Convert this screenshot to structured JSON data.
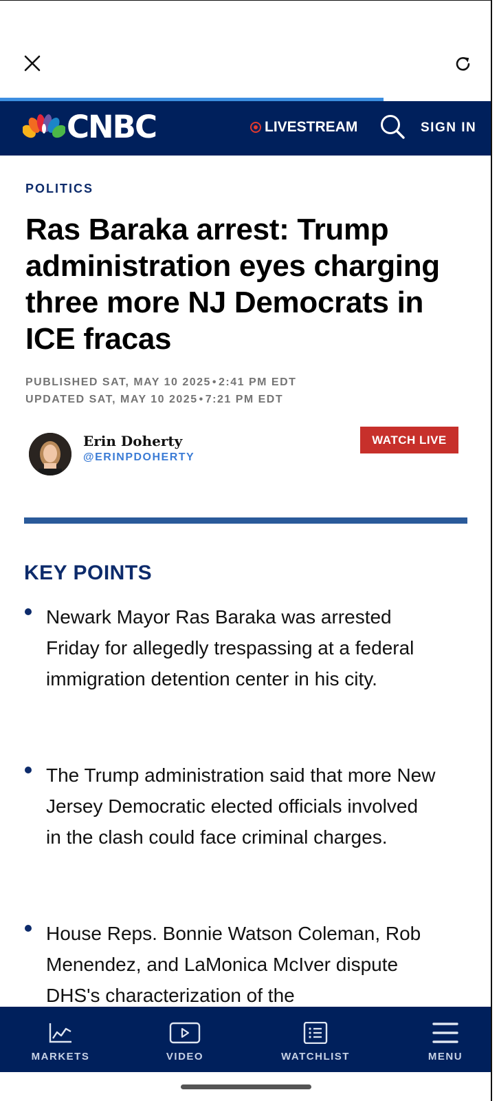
{
  "browser": {
    "close_icon": "close-icon",
    "reload_icon": "reload-icon",
    "load_progress": 0.78,
    "progress_color": "#3c8ee0"
  },
  "header": {
    "logo_text": "CNBC",
    "livestream_label": "LIVESTREAM",
    "signin_label": "SIGN IN",
    "bg_color": "#00205c",
    "live_dot_color": "#e23a2f"
  },
  "article": {
    "section": "POLITICS",
    "headline": "Ras Baraka arrest: Trump administration eyes charging three more NJ Democrats in ICE fracas",
    "published_prefix": "PUBLISHED SAT, MAY 10 2025",
    "published_time": "2:41 PM EDT",
    "updated_prefix": "UPDATED SAT, MAY 10 2025",
    "updated_time": "7:21 PM EDT",
    "separator": "•",
    "author_name": "Erin Doherty",
    "author_handle": "@ERINPDOHERTY",
    "watch_live_label": "WATCH LIVE",
    "watch_live_color": "#c7302b"
  },
  "key_points": {
    "title": "KEY POINTS",
    "items": [
      "Newark Mayor Ras Baraka was arrested Friday for allegedly trespassing at a federal immigration detention center in his city.",
      "The Trump administration said that more New Jersey Democratic elected officials involved in the clash could face criminal charges.",
      "House Reps. Bonnie Watson Coleman, Rob Menendez, and LaMonica McIver dispute DHS's characterization of the"
    ]
  },
  "bottom_nav": {
    "items": [
      {
        "label": "MARKETS",
        "icon": "chart-line-icon"
      },
      {
        "label": "VIDEO",
        "icon": "play-icon"
      },
      {
        "label": "WATCHLIST",
        "icon": "list-icon"
      },
      {
        "label": "MENU",
        "icon": "hamburger-icon"
      }
    ]
  }
}
